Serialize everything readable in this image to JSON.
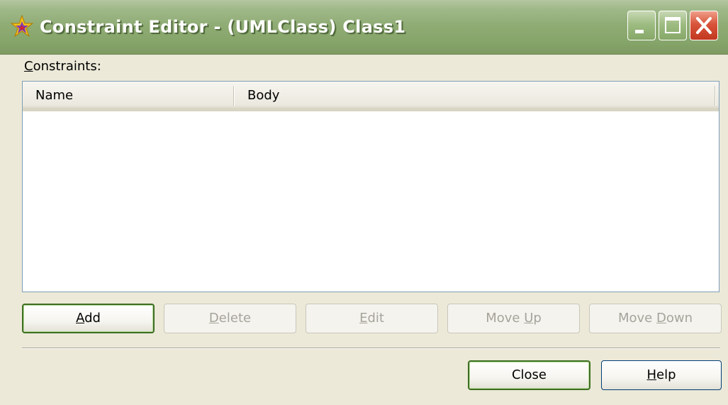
{
  "window": {
    "title": "Constraint Editor - (UMLClass) Class1",
    "buttons": {
      "minimize_icon": "minimize-icon",
      "maximize_icon": "maximize-icon",
      "close_icon": "close-icon"
    },
    "icon": "star-icon"
  },
  "constraints": {
    "label": "Constraints:",
    "label_mnemonic": "C",
    "label_rest": "onstraints:",
    "columns": [
      "Name",
      "Body"
    ],
    "rows": []
  },
  "actions": {
    "add": {
      "mn": "A",
      "rest": "dd",
      "enabled": true
    },
    "delete": {
      "mn": "D",
      "rest": "elete",
      "enabled": false
    },
    "edit": {
      "mn": "E",
      "rest": "dit",
      "enabled": false
    },
    "move_up": {
      "pre": "Move ",
      "mn": "U",
      "rest": "p",
      "enabled": false
    },
    "move_down": {
      "pre": "Move ",
      "mn": "D",
      "rest": "own",
      "enabled": false
    }
  },
  "footer": {
    "close_label": "Close",
    "help": {
      "mn": "H",
      "rest": "elp"
    }
  },
  "colors": {
    "titlebar": "#8eab73",
    "window_bg": "#ece9d8",
    "close_button": "#d8543b",
    "list_border": "#7f9db9"
  }
}
